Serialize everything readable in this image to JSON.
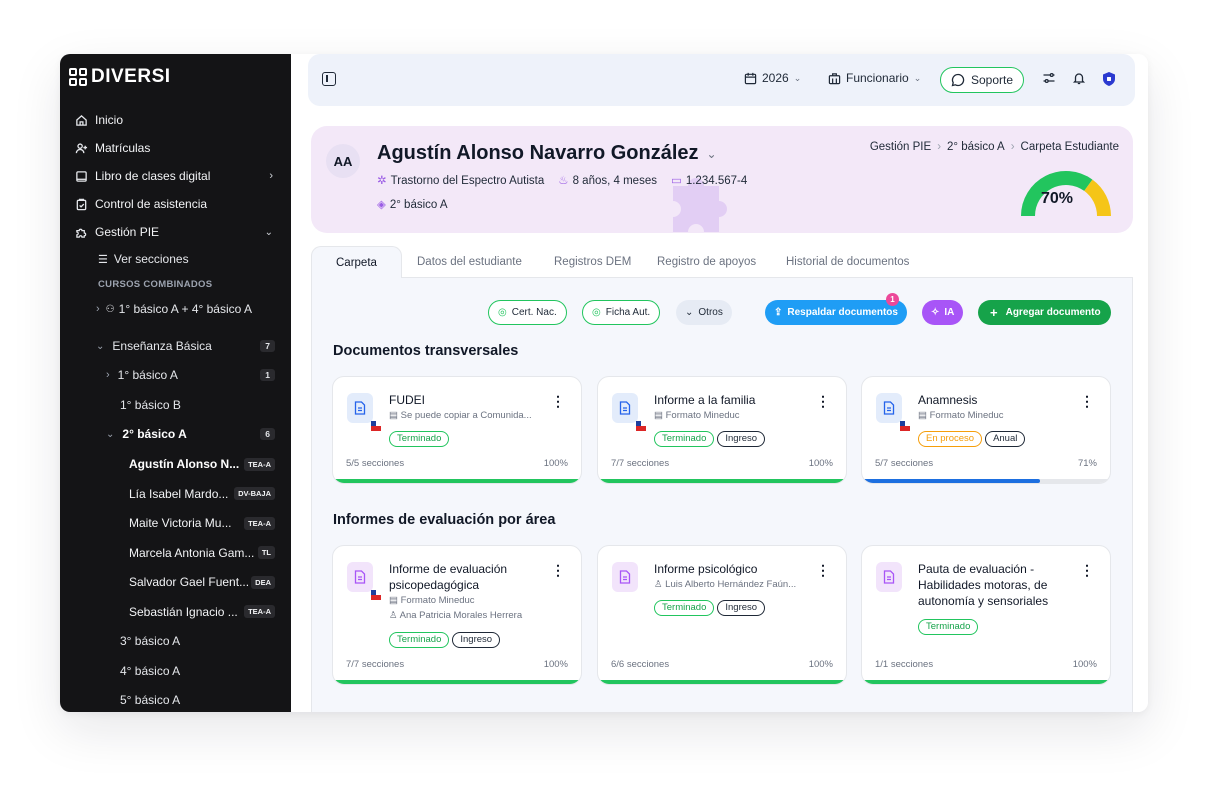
{
  "app": {
    "logo": "DIVERSI"
  },
  "sidebar": {
    "items": [
      {
        "label": "Inicio",
        "icon": "home-icon"
      },
      {
        "label": "Matrículas",
        "icon": "user-plus-icon"
      },
      {
        "label": "Libro de clases digital",
        "icon": "book-icon"
      },
      {
        "label": "Control de asistencia",
        "icon": "clipboard-check-icon"
      },
      {
        "label": "Gestión PIE",
        "icon": "puzzle-icon"
      }
    ],
    "ver_secciones": "Ver secciones",
    "cursos_combinados_label": "CURSOS COMBINADOS",
    "combined_course": "1° básico A + 4° básico A",
    "level": {
      "label": "Enseñanza Básica",
      "count": "7"
    },
    "courses": [
      {
        "label": "1° básico A",
        "count": "1"
      },
      {
        "label": "1° básico B"
      },
      {
        "label": "2° básico A",
        "count": "6"
      }
    ],
    "students": [
      {
        "name": "Agustín Alonso N...",
        "tag": "TEA-A"
      },
      {
        "name": "Lía Isabel Mardo...",
        "tag": "DV-BAJA"
      },
      {
        "name": "Maite Victoria Mu...",
        "tag": "TEA-A"
      },
      {
        "name": "Marcela Antonia Gam...",
        "tag": "TL"
      },
      {
        "name": "Salvador Gael Fuent...",
        "tag": "DEA"
      },
      {
        "name": "Sebastián Ignacio ...",
        "tag": "TEA-A"
      }
    ],
    "more_courses": [
      "3° básico A",
      "4° básico A",
      "5° básico A"
    ]
  },
  "topbar": {
    "year": "2026",
    "role": "Funcionario",
    "support": "Soporte"
  },
  "student": {
    "initials": "AA",
    "name": "Agustín Alonso Navarro González",
    "diagnosis": "Trastorno del Espectro Autista",
    "age": "8 años, 4 meses",
    "rut": "1.234.567-4",
    "course": "2° básico A",
    "progress": 0.7,
    "progress_label": "70%"
  },
  "breadcrumb": [
    "Gestión PIE",
    "2° básico A",
    "Carpeta Estudiante"
  ],
  "tabs": [
    "Carpeta",
    "Datos del estudiante",
    "Registros DEM",
    "Registro de apoyos",
    "Historial de documentos"
  ],
  "toolbar": {
    "cert": "Cert. Nac.",
    "ficha": "Ficha Aut.",
    "otros": "Otros",
    "respaldar": "Respaldar documentos",
    "respaldar_badge": "1",
    "ia": "IA",
    "agregar": "Agregar documento"
  },
  "sections": {
    "transversales": "Documentos transversales",
    "evaluacion": "Informes de evaluación por área"
  },
  "docs_transversales": [
    {
      "title": "FUDEI",
      "sub": "Se puede copiar a Comunida...",
      "pills": [
        "Terminado"
      ],
      "sections": "5/5 secciones",
      "pct": "100%",
      "progress": 1.0,
      "color": "#22c55e"
    },
    {
      "title": "Informe a la familia",
      "sub": "Formato Mineduc",
      "pills": [
        "Terminado",
        "Ingreso"
      ],
      "sections": "7/7 secciones",
      "pct": "100%",
      "progress": 1.0,
      "color": "#22c55e"
    },
    {
      "title": "Anamnesis",
      "sub": "Formato Mineduc",
      "pills": [
        "En proceso",
        "Anual"
      ],
      "sections": "5/7 secciones",
      "pct": "71%",
      "progress": 0.71,
      "color": "#1d6fe0"
    }
  ],
  "docs_evaluacion": [
    {
      "title": "Informe de evaluación psicopedagógica",
      "sub": "Formato Mineduc",
      "sub2": "Ana Patricia Morales Herrera",
      "pills": [
        "Terminado",
        "Ingreso"
      ],
      "sections": "7/7 secciones",
      "pct": "100%",
      "progress": 1.0
    },
    {
      "title": "Informe psicológico",
      "sub": "Luis Alberto Hernández Faún...",
      "pills": [
        "Terminado",
        "Ingreso"
      ],
      "sections": "6/6 secciones",
      "pct": "100%",
      "progress": 1.0
    },
    {
      "title": "Pauta de evaluación - Habilidades motoras, de autonomía y sensoriales",
      "pills": [
        "Terminado"
      ],
      "sections": "1/1 secciones",
      "pct": "100%",
      "progress": 1.0
    }
  ],
  "colors": {
    "accent_green": "#16a34a",
    "accent_blue": "#1f9df5",
    "accent_purple": "#a855f7",
    "hero_bg": "#f3e8f8"
  }
}
